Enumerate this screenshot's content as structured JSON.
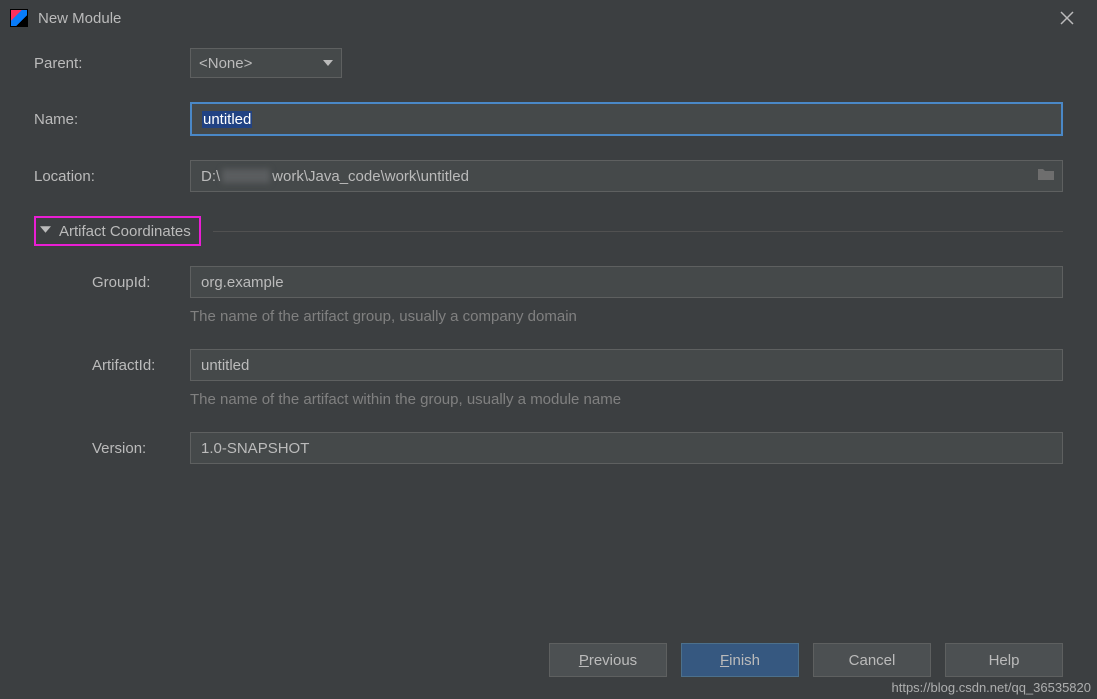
{
  "titlebar": {
    "title": "New Module"
  },
  "form": {
    "parent": {
      "label": "Parent:",
      "value": "<None>"
    },
    "name": {
      "label": "Name:",
      "value": "untitled"
    },
    "location": {
      "label": "Location:",
      "prefix": "D:\\",
      "suffix": "work\\Java_code\\work\\untitled"
    }
  },
  "section": {
    "title": "Artifact Coordinates",
    "groupId": {
      "label": "GroupId:",
      "value": "org.example",
      "hint": "The name of the artifact group, usually a company domain"
    },
    "artifactId": {
      "label": "ArtifactId:",
      "value": "untitled",
      "hint": "The name of the artifact within the group, usually a module name"
    },
    "version": {
      "label": "Version:",
      "value": "1.0-SNAPSHOT"
    }
  },
  "buttons": {
    "previous": "Previous",
    "finish": "Finish",
    "cancel": "Cancel",
    "help": "Help"
  },
  "watermark": "https://blog.csdn.net/qq_36535820"
}
